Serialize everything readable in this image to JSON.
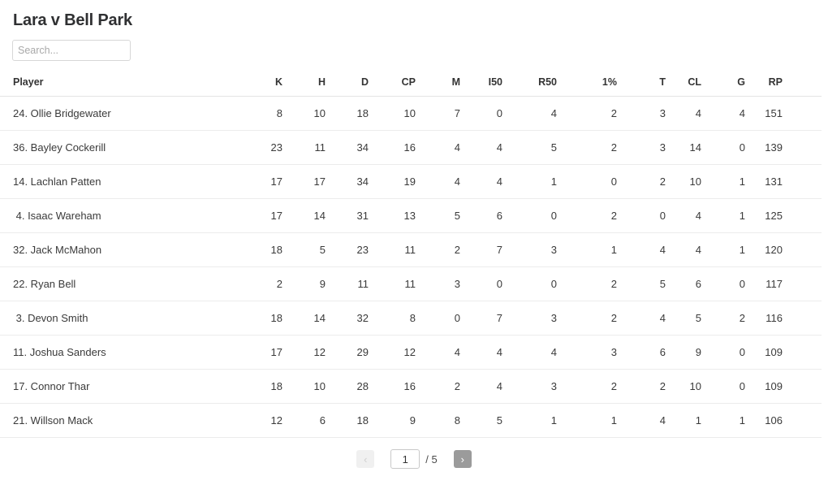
{
  "header": {
    "title": "Lara v Bell Park"
  },
  "search": {
    "placeholder": "Search...",
    "value": ""
  },
  "table": {
    "columns": [
      {
        "key": "player",
        "label": "Player"
      },
      {
        "key": "k",
        "label": "K"
      },
      {
        "key": "h",
        "label": "H"
      },
      {
        "key": "d",
        "label": "D"
      },
      {
        "key": "cp",
        "label": "CP"
      },
      {
        "key": "m",
        "label": "M"
      },
      {
        "key": "i50",
        "label": "I50"
      },
      {
        "key": "r50",
        "label": "R50"
      },
      {
        "key": "onepct",
        "label": "1%"
      },
      {
        "key": "t",
        "label": "T"
      },
      {
        "key": "cl",
        "label": "CL"
      },
      {
        "key": "g",
        "label": "G"
      },
      {
        "key": "rp",
        "label": "RP"
      }
    ],
    "rows": [
      {
        "player": "24. Ollie Bridgewater",
        "k": "8",
        "h": "10",
        "d": "18",
        "cp": "10",
        "m": "7",
        "i50": "0",
        "r50": "4",
        "onepct": "2",
        "t": "3",
        "cl": "4",
        "g": "4",
        "rp": "151"
      },
      {
        "player": "36. Bayley Cockerill",
        "k": "23",
        "h": "11",
        "d": "34",
        "cp": "16",
        "m": "4",
        "i50": "4",
        "r50": "5",
        "onepct": "2",
        "t": "3",
        "cl": "14",
        "g": "0",
        "rp": "139"
      },
      {
        "player": "14. Lachlan Patten",
        "k": "17",
        "h": "17",
        "d": "34",
        "cp": "19",
        "m": "4",
        "i50": "4",
        "r50": "1",
        "onepct": "0",
        "t": "2",
        "cl": "10",
        "g": "1",
        "rp": "131"
      },
      {
        "player": " 4. Isaac Wareham",
        "k": "17",
        "h": "14",
        "d": "31",
        "cp": "13",
        "m": "5",
        "i50": "6",
        "r50": "0",
        "onepct": "2",
        "t": "0",
        "cl": "4",
        "g": "1",
        "rp": "125"
      },
      {
        "player": "32. Jack McMahon",
        "k": "18",
        "h": "5",
        "d": "23",
        "cp": "11",
        "m": "2",
        "i50": "7",
        "r50": "3",
        "onepct": "1",
        "t": "4",
        "cl": "4",
        "g": "1",
        "rp": "120"
      },
      {
        "player": "22. Ryan Bell",
        "k": "2",
        "h": "9",
        "d": "11",
        "cp": "11",
        "m": "3",
        "i50": "0",
        "r50": "0",
        "onepct": "2",
        "t": "5",
        "cl": "6",
        "g": "0",
        "rp": "117"
      },
      {
        "player": " 3. Devon Smith",
        "k": "18",
        "h": "14",
        "d": "32",
        "cp": "8",
        "m": "0",
        "i50": "7",
        "r50": "3",
        "onepct": "2",
        "t": "4",
        "cl": "5",
        "g": "2",
        "rp": "116"
      },
      {
        "player": "11. Joshua Sanders",
        "k": "17",
        "h": "12",
        "d": "29",
        "cp": "12",
        "m": "4",
        "i50": "4",
        "r50": "4",
        "onepct": "3",
        "t": "6",
        "cl": "9",
        "g": "0",
        "rp": "109"
      },
      {
        "player": "17. Connor Thar",
        "k": "18",
        "h": "10",
        "d": "28",
        "cp": "16",
        "m": "2",
        "i50": "4",
        "r50": "3",
        "onepct": "2",
        "t": "2",
        "cl": "10",
        "g": "0",
        "rp": "109"
      },
      {
        "player": "21. Willson Mack",
        "k": "12",
        "h": "6",
        "d": "18",
        "cp": "9",
        "m": "8",
        "i50": "5",
        "r50": "1",
        "onepct": "1",
        "t": "4",
        "cl": "1",
        "g": "1",
        "rp": "106"
      }
    ]
  },
  "pagination": {
    "prev_label": "‹",
    "next_label": "›",
    "current_page": "1",
    "total_label": "/ 5",
    "total_pages": "5"
  },
  "colors": {
    "text": "#333333",
    "border": "#ececec",
    "header_border": "#e4e4e4",
    "next_button": "#9b9b9b",
    "prev_button": "#f0f0f0"
  }
}
